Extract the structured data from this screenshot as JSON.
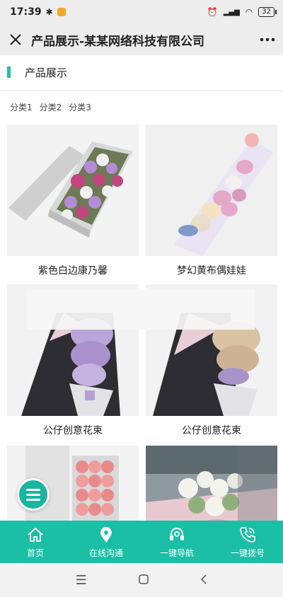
{
  "status_bar": {
    "time": "17:39",
    "battery": "32"
  },
  "title_bar": {
    "title": "产品展示-某某网络科技有限公司",
    "close_icon": "close-icon",
    "more_icon": "more-icon"
  },
  "section": {
    "title": "产品展示",
    "accent": "#1fbfa8"
  },
  "categories": [
    "分类1",
    "分类2",
    "分类3"
  ],
  "products": [
    {
      "name": "紫色白边康乃馨"
    },
    {
      "name": "梦幻黄布偶娃娃"
    },
    {
      "name": "公仔创意花束"
    },
    {
      "name": "公仔创意花束"
    },
    {
      "name": ""
    },
    {
      "name": ""
    }
  ],
  "bottom_nav": [
    {
      "label": "首页",
      "icon": "home-icon"
    },
    {
      "label": "在线沟通",
      "icon": "location-pin-icon"
    },
    {
      "label": "一键导航",
      "icon": "headset-icon"
    },
    {
      "label": "一键拨号",
      "icon": "phone-icon"
    }
  ],
  "colors": {
    "primary": "#1bbfa6",
    "fab": "#18b5a1"
  }
}
